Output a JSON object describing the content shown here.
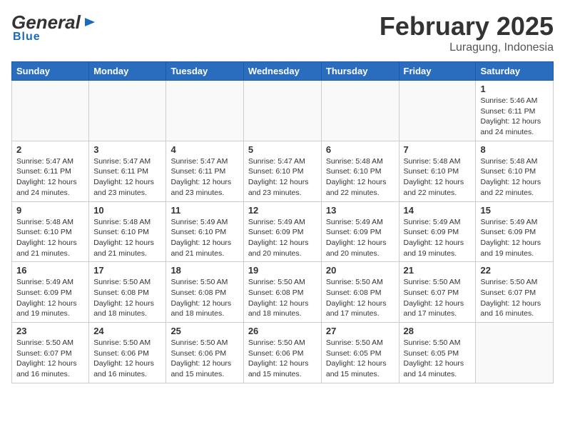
{
  "header": {
    "logo_general": "General",
    "logo_blue": "Blue",
    "month_title": "February 2025",
    "location": "Luragung, Indonesia"
  },
  "days_of_week": [
    "Sunday",
    "Monday",
    "Tuesday",
    "Wednesday",
    "Thursday",
    "Friday",
    "Saturday"
  ],
  "weeks": [
    [
      {
        "day": "",
        "info": ""
      },
      {
        "day": "",
        "info": ""
      },
      {
        "day": "",
        "info": ""
      },
      {
        "day": "",
        "info": ""
      },
      {
        "day": "",
        "info": ""
      },
      {
        "day": "",
        "info": ""
      },
      {
        "day": "1",
        "info": "Sunrise: 5:46 AM\nSunset: 6:11 PM\nDaylight: 12 hours\nand 24 minutes."
      }
    ],
    [
      {
        "day": "2",
        "info": "Sunrise: 5:47 AM\nSunset: 6:11 PM\nDaylight: 12 hours\nand 24 minutes."
      },
      {
        "day": "3",
        "info": "Sunrise: 5:47 AM\nSunset: 6:11 PM\nDaylight: 12 hours\nand 23 minutes."
      },
      {
        "day": "4",
        "info": "Sunrise: 5:47 AM\nSunset: 6:11 PM\nDaylight: 12 hours\nand 23 minutes."
      },
      {
        "day": "5",
        "info": "Sunrise: 5:47 AM\nSunset: 6:10 PM\nDaylight: 12 hours\nand 23 minutes."
      },
      {
        "day": "6",
        "info": "Sunrise: 5:48 AM\nSunset: 6:10 PM\nDaylight: 12 hours\nand 22 minutes."
      },
      {
        "day": "7",
        "info": "Sunrise: 5:48 AM\nSunset: 6:10 PM\nDaylight: 12 hours\nand 22 minutes."
      },
      {
        "day": "8",
        "info": "Sunrise: 5:48 AM\nSunset: 6:10 PM\nDaylight: 12 hours\nand 22 minutes."
      }
    ],
    [
      {
        "day": "9",
        "info": "Sunrise: 5:48 AM\nSunset: 6:10 PM\nDaylight: 12 hours\nand 21 minutes."
      },
      {
        "day": "10",
        "info": "Sunrise: 5:48 AM\nSunset: 6:10 PM\nDaylight: 12 hours\nand 21 minutes."
      },
      {
        "day": "11",
        "info": "Sunrise: 5:49 AM\nSunset: 6:10 PM\nDaylight: 12 hours\nand 21 minutes."
      },
      {
        "day": "12",
        "info": "Sunrise: 5:49 AM\nSunset: 6:09 PM\nDaylight: 12 hours\nand 20 minutes."
      },
      {
        "day": "13",
        "info": "Sunrise: 5:49 AM\nSunset: 6:09 PM\nDaylight: 12 hours\nand 20 minutes."
      },
      {
        "day": "14",
        "info": "Sunrise: 5:49 AM\nSunset: 6:09 PM\nDaylight: 12 hours\nand 19 minutes."
      },
      {
        "day": "15",
        "info": "Sunrise: 5:49 AM\nSunset: 6:09 PM\nDaylight: 12 hours\nand 19 minutes."
      }
    ],
    [
      {
        "day": "16",
        "info": "Sunrise: 5:49 AM\nSunset: 6:09 PM\nDaylight: 12 hours\nand 19 minutes."
      },
      {
        "day": "17",
        "info": "Sunrise: 5:50 AM\nSunset: 6:08 PM\nDaylight: 12 hours\nand 18 minutes."
      },
      {
        "day": "18",
        "info": "Sunrise: 5:50 AM\nSunset: 6:08 PM\nDaylight: 12 hours\nand 18 minutes."
      },
      {
        "day": "19",
        "info": "Sunrise: 5:50 AM\nSunset: 6:08 PM\nDaylight: 12 hours\nand 18 minutes."
      },
      {
        "day": "20",
        "info": "Sunrise: 5:50 AM\nSunset: 6:08 PM\nDaylight: 12 hours\nand 17 minutes."
      },
      {
        "day": "21",
        "info": "Sunrise: 5:50 AM\nSunset: 6:07 PM\nDaylight: 12 hours\nand 17 minutes."
      },
      {
        "day": "22",
        "info": "Sunrise: 5:50 AM\nSunset: 6:07 PM\nDaylight: 12 hours\nand 16 minutes."
      }
    ],
    [
      {
        "day": "23",
        "info": "Sunrise: 5:50 AM\nSunset: 6:07 PM\nDaylight: 12 hours\nand 16 minutes."
      },
      {
        "day": "24",
        "info": "Sunrise: 5:50 AM\nSunset: 6:06 PM\nDaylight: 12 hours\nand 16 minutes."
      },
      {
        "day": "25",
        "info": "Sunrise: 5:50 AM\nSunset: 6:06 PM\nDaylight: 12 hours\nand 15 minutes."
      },
      {
        "day": "26",
        "info": "Sunrise: 5:50 AM\nSunset: 6:06 PM\nDaylight: 12 hours\nand 15 minutes."
      },
      {
        "day": "27",
        "info": "Sunrise: 5:50 AM\nSunset: 6:05 PM\nDaylight: 12 hours\nand 15 minutes."
      },
      {
        "day": "28",
        "info": "Sunrise: 5:50 AM\nSunset: 6:05 PM\nDaylight: 12 hours\nand 14 minutes."
      },
      {
        "day": "",
        "info": ""
      }
    ]
  ]
}
